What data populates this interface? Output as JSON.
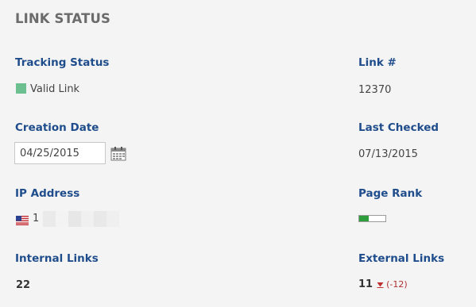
{
  "title": "LINK STATUS",
  "tracking_status": {
    "label": "Tracking Status",
    "value": "Valid Link",
    "color": "#6cc08f"
  },
  "link_number": {
    "label": "Link #",
    "value": "12370"
  },
  "creation_date": {
    "label": "Creation Date",
    "value": "04/25/2015",
    "icon": "calendar-icon"
  },
  "last_checked": {
    "label": "Last Checked",
    "value": "07/13/2015"
  },
  "ip_address": {
    "label": "IP Address",
    "value_visible": "1",
    "flag": "us-flag-icon"
  },
  "page_rank": {
    "label": "Page Rank",
    "fraction": 0.35,
    "fill_color": "#2e9e3d"
  },
  "internal_links": {
    "label": "Internal Links",
    "value": "22"
  },
  "external_links": {
    "label": "External Links",
    "value": "11",
    "delta": "(-12)",
    "trend_icon": "down-arrow-icon",
    "delta_color": "#b03030"
  }
}
